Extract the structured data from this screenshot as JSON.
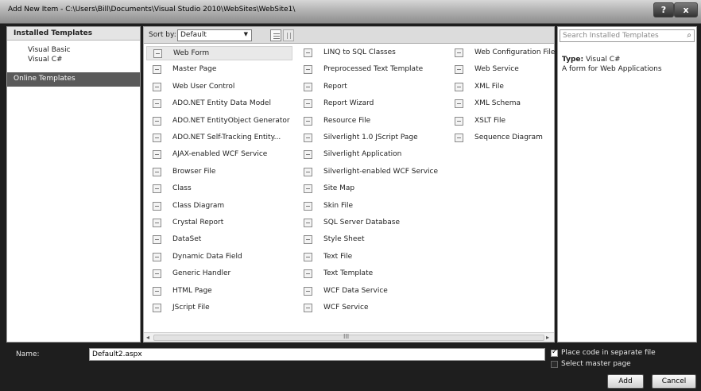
{
  "window": {
    "title": "Add New Item - C:\\Users\\Bill\\Documents\\Visual Studio 2010\\WebSites\\WebSite1\\",
    "help_label": "?",
    "close_label": "x"
  },
  "left_panel": {
    "installed_header": "Installed Templates",
    "languages": [
      "Visual Basic",
      "Visual C#"
    ],
    "online_label": "Online Templates"
  },
  "toolbar": {
    "sort_label": "Sort by:",
    "sort_value": "Default",
    "sort_arrow": "▼"
  },
  "templates": {
    "columns": [
      [
        "Web Form",
        "Master Page",
        "Web User Control",
        "ADO.NET Entity Data Model",
        "ADO.NET EntityObject Generator",
        "ADO.NET Self-Tracking Entity...",
        "AJAX-enabled WCF Service",
        "Browser File",
        "Class",
        "Class Diagram",
        "Crystal Report",
        "DataSet",
        "Dynamic Data Field",
        "Generic Handler",
        "HTML Page",
        "JScript File"
      ],
      [
        "LINQ to SQL Classes",
        "Preprocessed Text Template",
        "Report",
        "Report Wizard",
        "Resource File",
        "Silverlight 1.0 JScript Page",
        "Silverlight Application",
        "Silverlight-enabled WCF Service",
        "Site Map",
        "Skin File",
        "SQL Server Database",
        "Style Sheet",
        "Text File",
        "Text Template",
        "WCF Data Service",
        "WCF Service"
      ],
      [
        "Web Configuration File",
        "Web Service",
        "XML File",
        "XML Schema",
        "XSLT File",
        "Sequence Diagram"
      ]
    ],
    "selected": "Web Form"
  },
  "scrollbar": {
    "left_arrow": "◂",
    "right_arrow": "▸",
    "grip": "III"
  },
  "right_panel": {
    "search_placeholder": "Search Installed Templates",
    "search_icon": "⌕",
    "type_label": "Type:",
    "type_value": "Visual C#",
    "description": "A form for Web Applications"
  },
  "footer": {
    "name_label": "Name:",
    "name_value": "Default2.aspx",
    "separate_file_label": "Place code in separate file",
    "separate_file_checked": true,
    "master_page_label": "Select master page",
    "master_page_checked": false,
    "add_label": "Add",
    "cancel_label": "Cancel"
  }
}
